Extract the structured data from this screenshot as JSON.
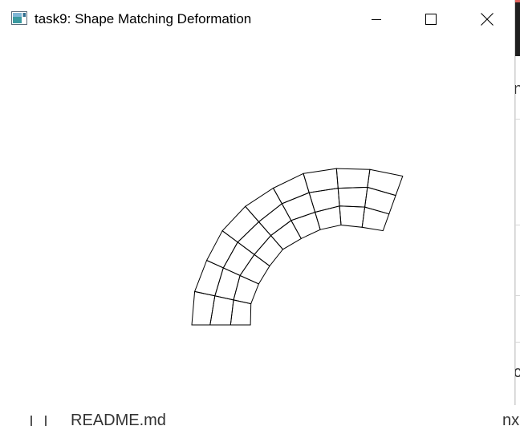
{
  "window": {
    "title": "task9: Shape Matching Deformation",
    "icon": "app-window-icon",
    "controls": {
      "minimize": "minimize-icon",
      "maximize": "maximize-icon",
      "close": "close-icon"
    }
  },
  "scene": {
    "description_shape": "deformed-grid",
    "stroke_color": "#000000",
    "background_color": "#ffffff"
  },
  "background_app": {
    "bottom_text": "README.md",
    "bottom_right_text": "nx",
    "right_char_top": "n",
    "right_char_bottom": "c"
  }
}
